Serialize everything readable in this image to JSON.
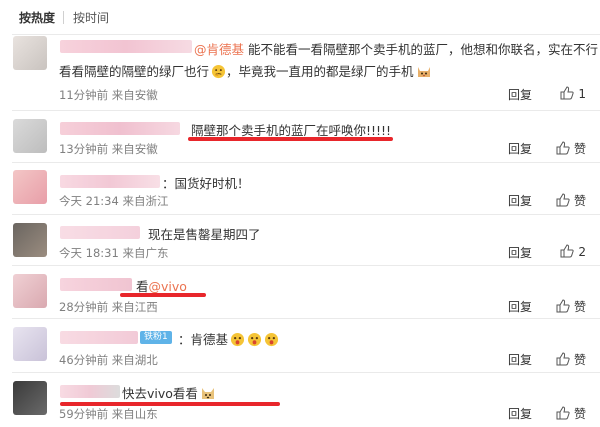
{
  "sort": {
    "hot": "按热度",
    "time": "按时间"
  },
  "comments": [
    {
      "mention": "@肯德基",
      "text": "能不能看一看隔壁那个卖手机的蓝厂，他想和你联名，实在不行",
      "text2": "看看隔壁的隔壁的绿厂也行",
      "text3": "，毕竟我一直用的都是绿厂的手机",
      "meta": "11分钟前 来自安徽",
      "reply": "回复",
      "like": "1"
    },
    {
      "text": "隔壁那个卖手机的蓝厂在呼唤你!!!!!",
      "meta": "13分钟前 来自安徽",
      "reply": "回复",
      "like": "赞"
    },
    {
      "text": "：国货好时机！",
      "meta": "今天 21:34 来自浙江",
      "reply": "回复",
      "like": "赞"
    },
    {
      "text": "现在是售罄星期四了",
      "meta": "今天 18:31 来自广东",
      "reply": "回复",
      "like": "2"
    },
    {
      "text": "看",
      "mention": "@vivo",
      "meta": "28分钟前 来自江西",
      "reply": "回复",
      "like": "赞"
    },
    {
      "badge": "铁粉1",
      "text": "：肯德基",
      "meta": "46分钟前 来自湖北",
      "reply": "回复",
      "like": "赞"
    },
    {
      "text": "快去vivo看看",
      "meta": "59分钟前 来自山东",
      "reply": "回复",
      "like": "赞"
    }
  ]
}
